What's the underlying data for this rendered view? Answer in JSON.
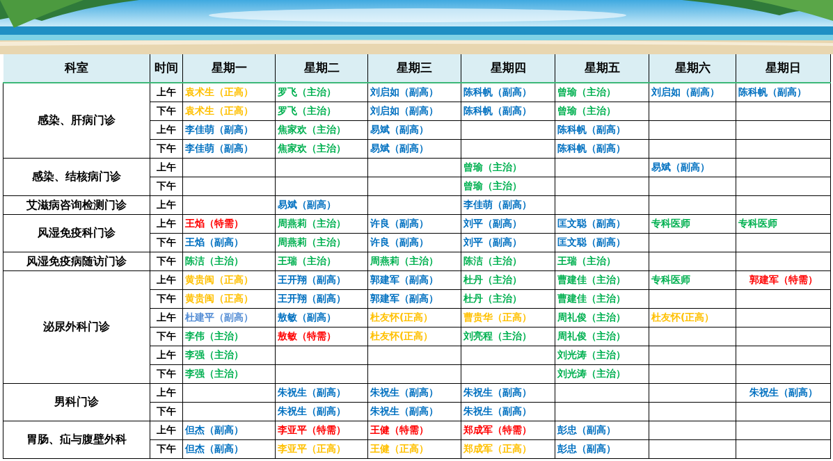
{
  "header": {
    "department": "科室",
    "time": "时间",
    "days": [
      "星期一",
      "星期二",
      "星期三",
      "星期四",
      "星期五",
      "星期六",
      "星期日"
    ]
  },
  "departments": [
    {
      "name": "感染、肝病门诊",
      "sessions": [
        {
          "time": "上午",
          "cells": [
            {
              "text": "袁术生（正高）",
              "color": "#ffc000"
            },
            {
              "text": "罗飞（主治）",
              "color": "#00b050"
            },
            {
              "text": "刘启如（副高）",
              "color": "#0070c0"
            },
            {
              "text": "陈科帆（副高）",
              "color": "#0070c0"
            },
            {
              "text": "曾瑜（主治）",
              "color": "#00b050"
            },
            {
              "text": "刘启如（副高）",
              "color": "#0070c0"
            },
            {
              "text": "陈科帆（副高）",
              "color": "#0070c0"
            }
          ]
        },
        {
          "time": "下午",
          "cells": [
            {
              "text": "袁术生（正高）",
              "color": "#ffc000"
            },
            {
              "text": "罗飞（主治）",
              "color": "#00b050"
            },
            {
              "text": "刘启如（副高）",
              "color": "#0070c0"
            },
            {
              "text": "陈科帆（副高）",
              "color": "#0070c0"
            },
            {
              "text": "曾瑜（主治）",
              "color": "#00b050"
            },
            null,
            null
          ]
        },
        {
          "time": "上午",
          "cells": [
            {
              "text": "李佳萌（副高）",
              "color": "#0070c0"
            },
            {
              "text": "焦家欢（主治）",
              "color": "#00b050"
            },
            {
              "text": "易斌（副高）",
              "color": "#0070c0"
            },
            null,
            {
              "text": "陈科帆（副高）",
              "color": "#0070c0"
            },
            null,
            null
          ]
        },
        {
          "time": "下午",
          "cells": [
            {
              "text": "李佳萌（副高）",
              "color": "#0070c0"
            },
            {
              "text": "焦家欢（主治）",
              "color": "#00b050"
            },
            {
              "text": "易斌（副高）",
              "color": "#0070c0"
            },
            null,
            {
              "text": "陈科帆（副高）",
              "color": "#0070c0"
            },
            null,
            null
          ]
        }
      ]
    },
    {
      "name": "感染、结核病门诊",
      "sessions": [
        {
          "time": "上午",
          "cells": [
            null,
            null,
            null,
            {
              "text": "曾瑜（主治）",
              "color": "#00b050"
            },
            null,
            {
              "text": "易斌（副高）",
              "color": "#0070c0"
            },
            null
          ]
        },
        {
          "time": "下午",
          "cells": [
            null,
            null,
            null,
            {
              "text": "曾瑜（主治）",
              "color": "#00b050"
            },
            null,
            null,
            null
          ]
        }
      ]
    },
    {
      "name": "艾滋病咨询检测门诊",
      "sessions": [
        {
          "time": "上午",
          "cells": [
            null,
            {
              "text": "易斌（副高）",
              "color": "#0070c0"
            },
            null,
            {
              "text": "李佳萌（副高）",
              "color": "#0070c0"
            },
            null,
            null,
            null
          ]
        }
      ]
    },
    {
      "name": "风湿免疫科门诊",
      "sessions": [
        {
          "time": "上午",
          "cells": [
            {
              "text": "王焰（特需）",
              "color": "#ff0000"
            },
            {
              "text": "周燕莉（主治）",
              "color": "#00b050"
            },
            {
              "text": "许良（副高）",
              "color": "#0070c0"
            },
            {
              "text": "刘平（副高）",
              "color": "#0070c0"
            },
            {
              "text": "匡文聪（副高）",
              "color": "#0070c0"
            },
            {
              "text": "专科医师",
              "color": "#00b050"
            },
            {
              "text": "专科医师",
              "color": "#00b050"
            }
          ]
        },
        {
          "time": "下午",
          "cells": [
            {
              "text": "王焰（副高）",
              "color": "#0070c0"
            },
            {
              "text": "周燕莉（主治）",
              "color": "#00b050"
            },
            {
              "text": "许良（副高）",
              "color": "#0070c0"
            },
            {
              "text": "刘平（副高）",
              "color": "#0070c0"
            },
            {
              "text": "匡文聪（副高）",
              "color": "#0070c0"
            },
            null,
            null
          ]
        }
      ]
    },
    {
      "name": "风湿免疫病随访门诊",
      "sessions": [
        {
          "time": "下午",
          "cells": [
            {
              "text": "陈洁（主治）",
              "color": "#00b050"
            },
            {
              "text": "王瑞（主治）",
              "color": "#00b050"
            },
            {
              "text": "周燕莉（主治）",
              "color": "#00b050"
            },
            {
              "text": "陈洁（主治）",
              "color": "#00b050"
            },
            {
              "text": "王瑞（主治）",
              "color": "#00b050"
            },
            null,
            null
          ]
        }
      ]
    },
    {
      "name": "泌尿外科门诊",
      "sessions": [
        {
          "time": "上午",
          "cells": [
            {
              "text": "黄贵闽（正高）",
              "color": "#ffc000"
            },
            {
              "text": "王开翔（副高）",
              "color": "#0070c0"
            },
            {
              "text": "郭建军（副高）",
              "color": "#0070c0"
            },
            {
              "text": "杜丹（主治）",
              "color": "#00b050"
            },
            {
              "text": "曹建佳（主治）",
              "color": "#00b050"
            },
            {
              "text": "专科医师",
              "color": "#00b050"
            },
            {
              "text": "郭建军（特需）",
              "color": "#ff0000",
              "centered": true
            }
          ]
        },
        {
          "time": "下午",
          "cells": [
            {
              "text": "黄贵闽（正高）",
              "color": "#ffc000"
            },
            {
              "text": "王开翔（副高）",
              "color": "#0070c0"
            },
            {
              "text": "郭建军（副高）",
              "color": "#0070c0"
            },
            {
              "text": "杜丹（主治）",
              "color": "#00b050"
            },
            {
              "text": "曹建佳（主治）",
              "color": "#00b050"
            },
            null,
            null
          ]
        },
        {
          "time": "上午",
          "cells": [
            {
              "text": "杜建平（副高）",
              "color": "#558ed5"
            },
            {
              "text": "敖敏（副高）",
              "color": "#0070c0"
            },
            {
              "text": "杜友怀(正高）",
              "color": "#ffc000"
            },
            {
              "text": "曹贵华（正高）",
              "color": "#ffc000"
            },
            {
              "text": "周礼俊（主治）",
              "color": "#00b050"
            },
            {
              "text": "杜友怀(正高）",
              "color": "#ffc000"
            },
            null
          ]
        },
        {
          "time": "下午",
          "cells": [
            {
              "text": "李伟（主治）",
              "color": "#00b050"
            },
            {
              "text": "敖敏（特需）",
              "color": "#ff0000"
            },
            {
              "text": "杜友怀(正高）",
              "color": "#ffc000"
            },
            {
              "text": "刘亮程（主治）",
              "color": "#00b050"
            },
            {
              "text": "周礼俊（主治）",
              "color": "#00b050"
            },
            null,
            null
          ]
        },
        {
          "time": "上午",
          "cells": [
            {
              "text": "李强（主治）",
              "color": "#00b050"
            },
            null,
            null,
            null,
            {
              "text": "刘光涛（主治）",
              "color": "#00b050"
            },
            null,
            null
          ]
        },
        {
          "time": "下午",
          "cells": [
            {
              "text": "李强（主治）",
              "color": "#00b050"
            },
            null,
            null,
            null,
            {
              "text": "刘光涛（主治）",
              "color": "#00b050"
            },
            null,
            null
          ]
        }
      ]
    },
    {
      "name": "男科门诊",
      "sessions": [
        {
          "time": "上午",
          "cells": [
            null,
            {
              "text": "朱祝生（副高）",
              "color": "#0070c0"
            },
            {
              "text": "朱祝生（副高）",
              "color": "#0070c0"
            },
            {
              "text": "朱祝生（副高）",
              "color": "#0070c0"
            },
            null,
            null,
            {
              "text": "朱祝生（副高）",
              "color": "#0070c0",
              "centered": true
            }
          ]
        },
        {
          "time": "下午",
          "cells": [
            null,
            {
              "text": "朱祝生（副高）",
              "color": "#0070c0"
            },
            {
              "text": "朱祝生（副高）",
              "color": "#0070c0"
            },
            {
              "text": "朱祝生（副高）",
              "color": "#0070c0"
            },
            null,
            null,
            null
          ]
        }
      ]
    },
    {
      "name": "胃肠、疝与腹壁外科",
      "sessions": [
        {
          "time": "上午",
          "cells": [
            {
              "text": "但杰（副高）",
              "color": "#0070c0"
            },
            {
              "text": "李亚平（特需）",
              "color": "#ff0000"
            },
            {
              "text": "王健（特需）",
              "color": "#ff0000"
            },
            {
              "text": "郑成军（特需）",
              "color": "#ff0000"
            },
            {
              "text": "彭忠（副高）",
              "color": "#0070c0"
            },
            null,
            null
          ]
        },
        {
          "time": "下午",
          "cells": [
            {
              "text": "但杰（副高）",
              "color": "#0070c0"
            },
            {
              "text": "李亚平（正高）",
              "color": "#ffc000"
            },
            {
              "text": "王健（正高）",
              "color": "#ffc000"
            },
            {
              "text": "郑成军（正高）",
              "color": "#ffc000"
            },
            {
              "text": "彭忠（副高）",
              "color": "#0070c0"
            },
            null,
            null
          ]
        }
      ]
    }
  ]
}
